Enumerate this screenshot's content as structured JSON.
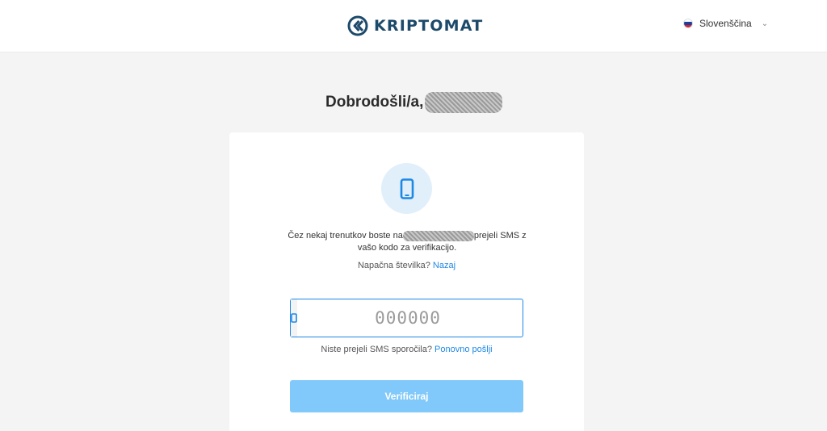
{
  "header": {
    "brand": "KRIPTOMAT",
    "language": {
      "label": "Slovenščina",
      "flag_colors": [
        "#ffffff",
        "#1c3f9e",
        "#d81e2a"
      ]
    }
  },
  "welcome": {
    "greeting": "Dobrodošli/a,"
  },
  "verification": {
    "icon": "mobile-phone-icon",
    "message_before": "Čez nekaj trenutkov boste na",
    "message_after": "prejeli SMS z vašo kodo za verifikacijo.",
    "wrong_number_text": "Napačna številka?",
    "back_link": "Nazaj",
    "code_placeholder": "000000",
    "code_value": "",
    "no_sms_text": "Niste prejeli SMS sporočila?",
    "resend_link": "Ponovno pošlji",
    "verify_label": "Verificiraj"
  },
  "colors": {
    "accent": "#1e88e5",
    "button_disabled": "#81c9fa",
    "brand": "#1d4a6b"
  }
}
